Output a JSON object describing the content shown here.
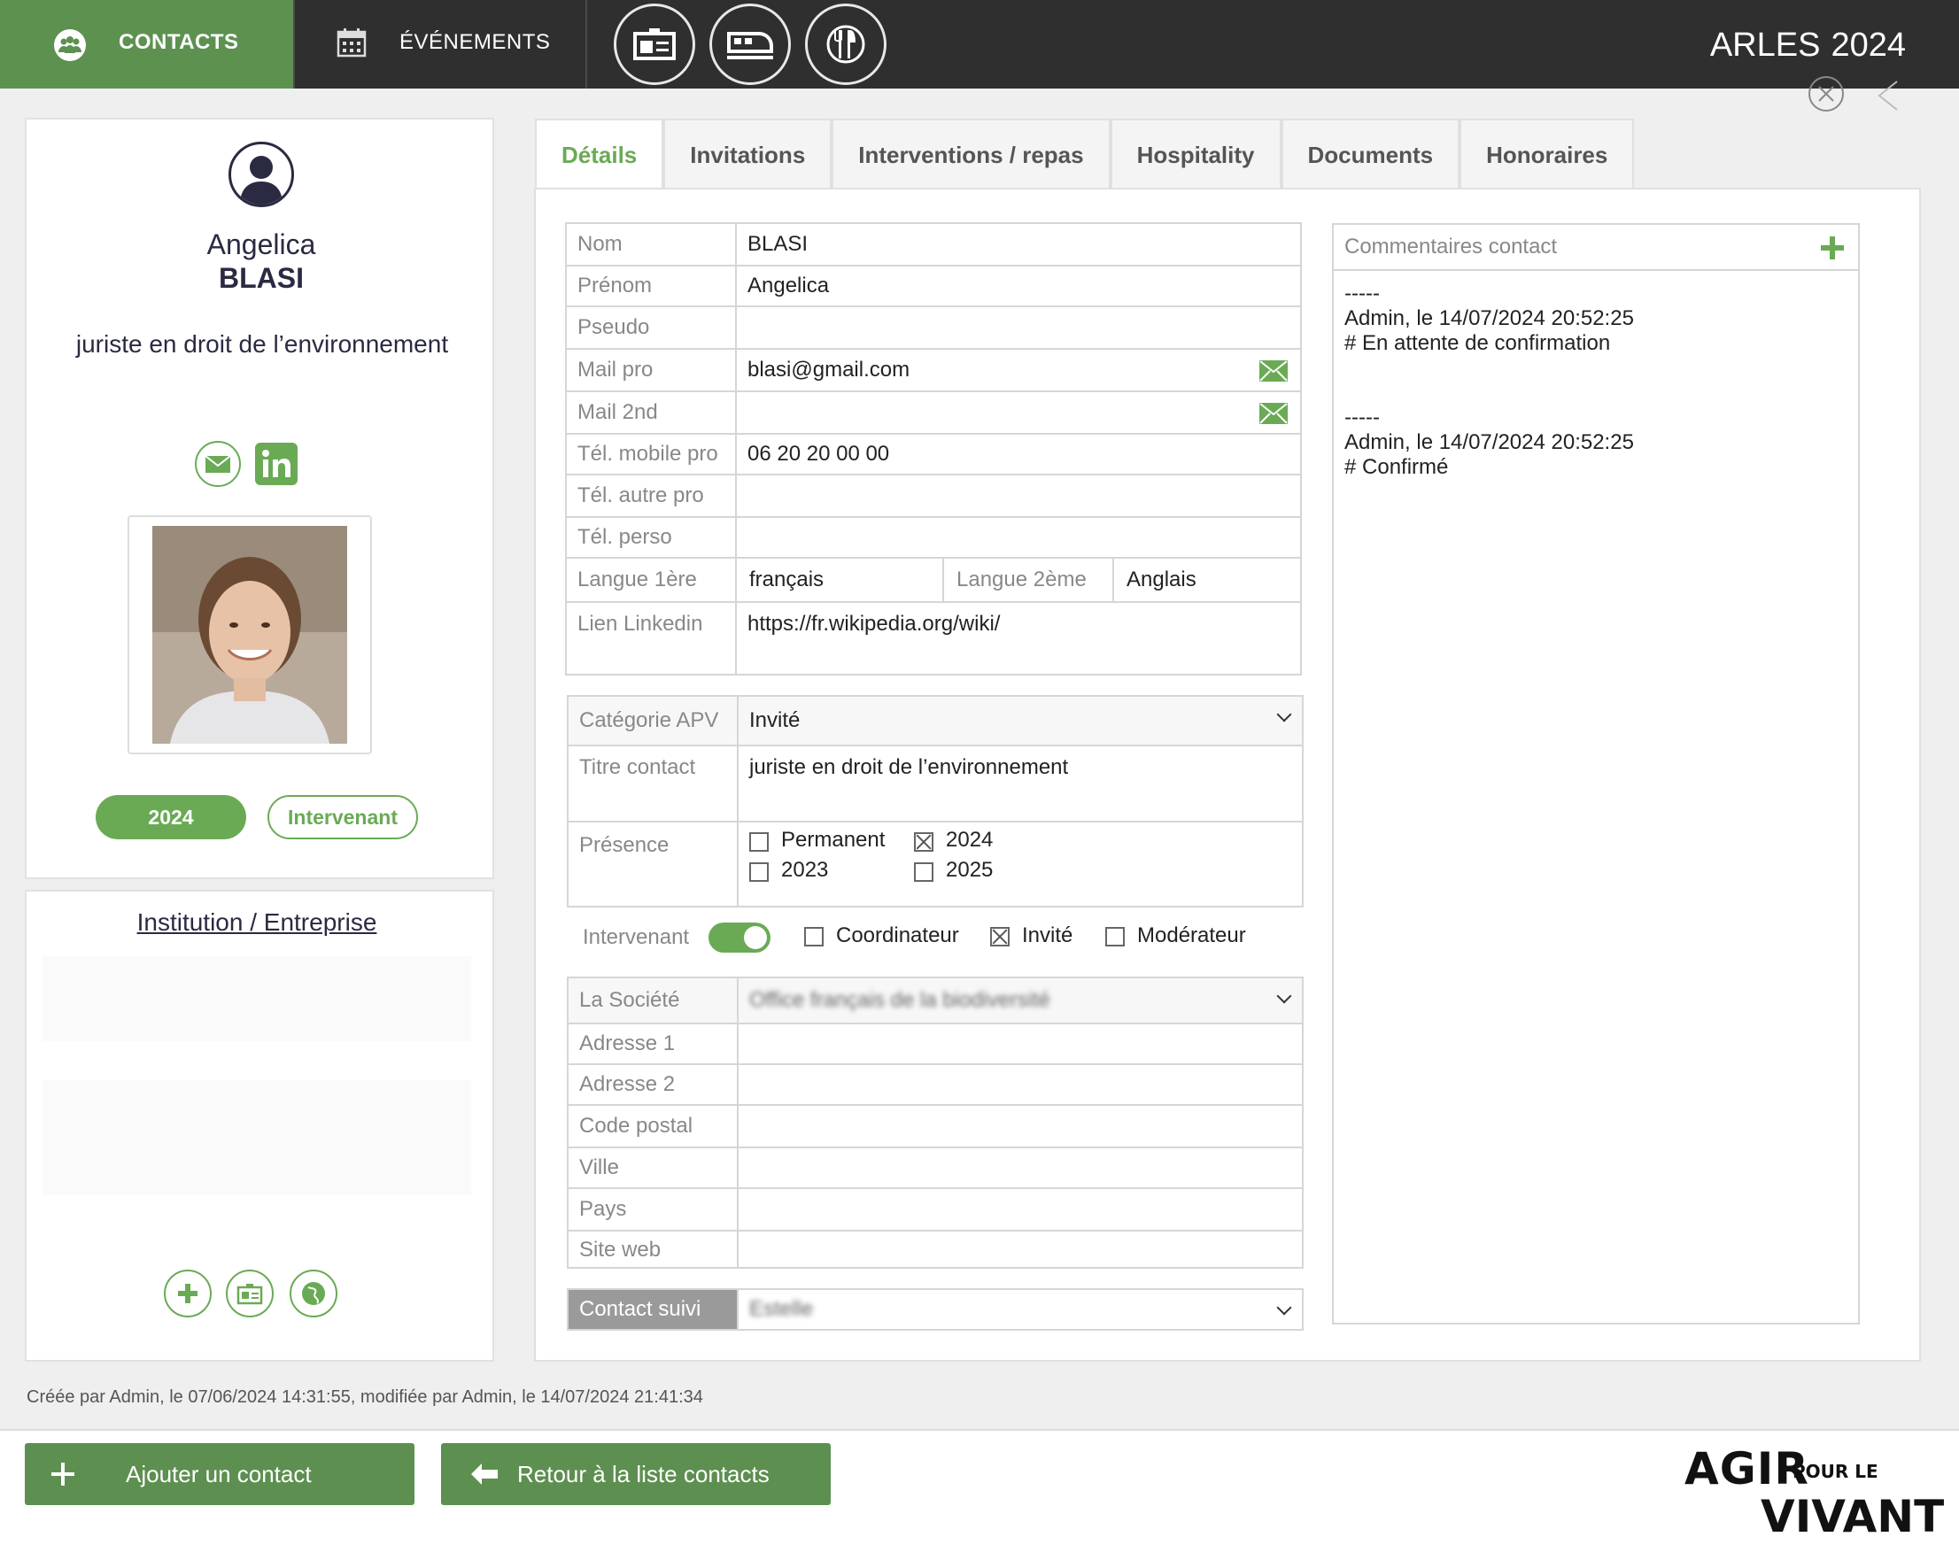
{
  "nav": {
    "contacts": "CONTACTS",
    "events": "ÉVÉNEMENTS",
    "city": "ARLES",
    "year": "2024"
  },
  "profile": {
    "first_name": "Angelica",
    "last_name": "BLASI",
    "title": "juriste en droit de l’environnement",
    "badge_year": "2024",
    "badge_role": "Intervenant",
    "institution_link": "Institution / Entreprise"
  },
  "tabs": [
    "Détails",
    "Invitations",
    "Interventions / repas",
    "Hospitality",
    "Documents",
    "Honoraires"
  ],
  "details": {
    "nom_label": "Nom",
    "nom": "BLASI",
    "prenom_label": "Prénom",
    "prenom": "Angelica",
    "pseudo_label": "Pseudo",
    "pseudo": "",
    "mail_pro_label": "Mail pro",
    "mail_pro": "blasi@gmail.com",
    "mail_2nd_label": "Mail 2nd",
    "mail_2nd": "",
    "tel_mobile_label": "Tél. mobile pro",
    "tel_mobile": "06 20 20 00 00",
    "tel_autre_label": "Tél. autre pro",
    "tel_autre": "",
    "tel_perso_label": "Tél. perso",
    "tel_perso": "",
    "langue1_label": "Langue 1ère",
    "langue1": "français",
    "langue2_label": "Langue 2ème",
    "langue2": "Anglais",
    "linkedin_label": "Lien Linkedin",
    "linkedin": "https://fr.wikipedia.org/wiki/"
  },
  "apv": {
    "categorie_label": "Catégorie APV",
    "categorie": "Invité",
    "titre_label": "Titre contact",
    "titre": "juriste en droit de l’environnement",
    "presence_label": "Présence",
    "presence": {
      "permanent": "Permanent",
      "y2023": "2023",
      "y2024": "2024",
      "y2025": "2025"
    }
  },
  "roles": {
    "intervenant": "Intervenant",
    "coordinateur": "Coordinateur",
    "invite": "Invité",
    "moderateur": "Modérateur"
  },
  "societe": {
    "societe_label": "La Société",
    "societe": "Office français de la biodiversité",
    "adresse1_label": "Adresse 1",
    "adresse2_label": "Adresse 2",
    "cp_label": "Code postal",
    "ville_label": "Ville",
    "pays_label": "Pays",
    "site_label": "Site web",
    "suivi_label": "Contact suivi",
    "suivi": "Estelle"
  },
  "comments": {
    "header": "Commentaires contact",
    "c1": "-----\nAdmin, le 14/07/2024 20:52:25\n# En attente de confirmation",
    "c2": "-----\nAdmin, le 14/07/2024 20:52:25\n# Confirmé"
  },
  "footer": {
    "meta": "Créée par Admin, le 07/06/2024 14:31:55, modifiée par Admin, le 14/07/2024 21:41:34",
    "add_contact": "Ajouter un contact",
    "back_list": "Retour à la liste contacts"
  },
  "logo": {
    "line1": "AGIR",
    "line1b": "POUR LE",
    "line2": "VIVANT"
  },
  "colors": {
    "accent": "#6aaa55",
    "topbar": "#2f2f2f",
    "button": "#5d8f50"
  }
}
